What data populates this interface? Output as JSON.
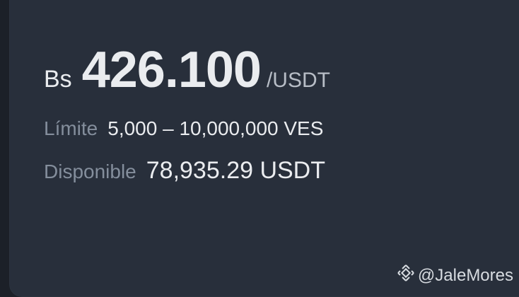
{
  "offer": {
    "currency_prefix": "Bs",
    "price": "426.100",
    "unit": "/USDT",
    "limit_label": "Límite",
    "limit_value": "5,000 – 10,000,000 VES",
    "available_label": "Disponible",
    "available_value": "78,935.29 USDT"
  },
  "watermark": {
    "icon": "binance-logo-icon",
    "text": "@JaleMores"
  },
  "colors": {
    "background": "#1c2028",
    "card": "#282f3b",
    "primary_text": "#eaecef",
    "secondary_text": "#848e9c"
  }
}
